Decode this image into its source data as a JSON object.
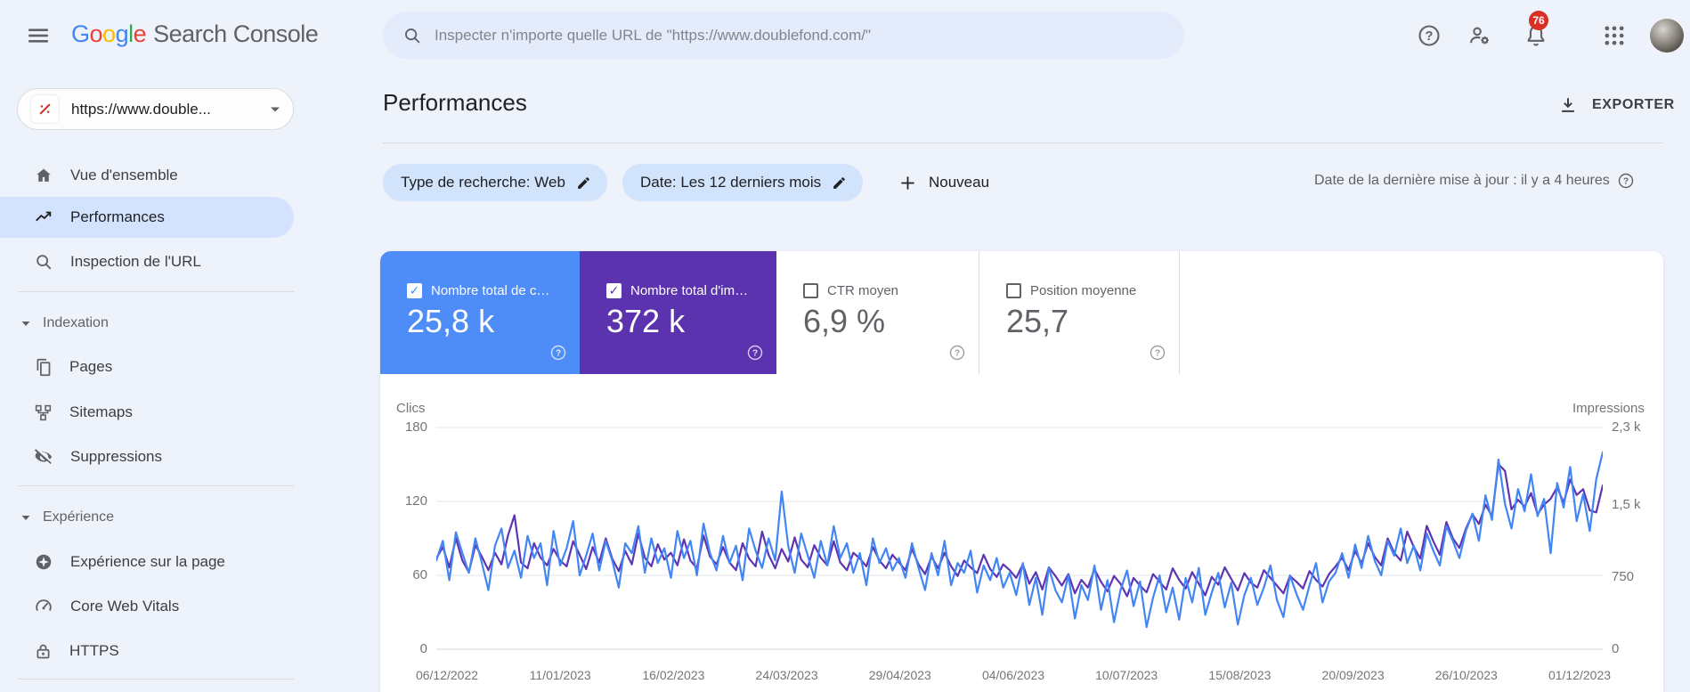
{
  "header": {
    "logo": {
      "letters": [
        {
          "ch": "G",
          "color": "#4285F4"
        },
        {
          "ch": "o",
          "color": "#EA4335"
        },
        {
          "ch": "o",
          "color": "#FBBC05"
        },
        {
          "ch": "g",
          "color": "#4285F4"
        },
        {
          "ch": "l",
          "color": "#34A853"
        },
        {
          "ch": "e",
          "color": "#EA4335"
        }
      ],
      "product": "Search Console"
    },
    "search": {
      "placeholder": "Inspecter n'importe quelle URL de \"https://www.doublefond.com/\""
    },
    "notifications_count": "76"
  },
  "sidebar": {
    "property": {
      "url": "https://www.double..."
    },
    "items": [
      {
        "label": "Vue d'ensemble"
      },
      {
        "label": "Performances"
      },
      {
        "label": "Inspection de l'URL"
      },
      {
        "label": "Pages"
      },
      {
        "label": "Sitemaps"
      },
      {
        "label": "Suppressions"
      },
      {
        "label": "Expérience sur la page"
      },
      {
        "label": "Core Web Vitals"
      },
      {
        "label": "HTTPS"
      }
    ],
    "sections": [
      {
        "label": "Indexation"
      },
      {
        "label": "Expérience"
      }
    ]
  },
  "main": {
    "title": "Performances",
    "export_label": "EXPORTER",
    "filters": {
      "chip_search_type": "Type de recherche: Web",
      "chip_date": "Date: Les 12 derniers mois",
      "new_label": "Nouveau",
      "updated_text": "Date de la dernière mise à jour : il y a 4 heures"
    },
    "metrics": [
      {
        "label": "Nombre total de c…",
        "value": "25,8 k",
        "checked": true,
        "color": "#4e8cf7"
      },
      {
        "label": "Nombre total d'im…",
        "value": "372 k",
        "checked": true,
        "color": "#5c33ae"
      },
      {
        "label": "CTR moyen",
        "value": "6,9 %",
        "checked": false,
        "color": "#ffffff"
      },
      {
        "label": "Position moyenne",
        "value": "25,7",
        "checked": false,
        "color": "#ffffff"
      }
    ],
    "chart_data": {
      "type": "line",
      "title": "",
      "left_axis": {
        "label": "Clics",
        "ticks": [
          180,
          120,
          60,
          0
        ],
        "tick_labels": [
          "180",
          "120",
          "60",
          "0"
        ],
        "max": 180
      },
      "right_axis": {
        "label": "Impressions",
        "ticks": [
          2300,
          1500,
          750,
          0
        ],
        "tick_labels": [
          "2,3 k",
          "1,5 k",
          "750",
          "0"
        ],
        "max": 2300
      },
      "x_labels": [
        "06/12/2022",
        "11/01/2023",
        "16/02/2023",
        "24/03/2023",
        "29/04/2023",
        "04/06/2023",
        "10/07/2023",
        "15/08/2023",
        "20/09/2023",
        "26/10/2023",
        "01/12/2023"
      ],
      "grid": true,
      "series": [
        {
          "name": "Clics",
          "color": "#4285f4",
          "axis": "left",
          "values": [
            72,
            88,
            56,
            95,
            78,
            62,
            90,
            70,
            48,
            84,
            98,
            66,
            80,
            58,
            92,
            74,
            86,
            52,
            96,
            68,
            82,
            104,
            60,
            76,
            94,
            64,
            88,
            72,
            50,
            86,
            78,
            100,
            62,
            90,
            70,
            82,
            58,
            96,
            74,
            88,
            60,
            102,
            78,
            64,
            92,
            70,
            84,
            56,
            98,
            80,
            66,
            90,
            72,
            128,
            84,
            62,
            94,
            76,
            58,
            88,
            68,
            100,
            74,
            86,
            62,
            78,
            52,
            90,
            70,
            82,
            64,
            74,
            58,
            86,
            66,
            48,
            78,
            60,
            88,
            52,
            70,
            62,
            80,
            46,
            68,
            56,
            74,
            50,
            62,
            44,
            70,
            36,
            58,
            28,
            66,
            48,
            38,
            60,
            25,
            52,
            40,
            68,
            32,
            56,
            22,
            48,
            64,
            35,
            55,
            18,
            42,
            60,
            30,
            50,
            24,
            58,
            38,
            66,
            28,
            46,
            62,
            34,
            54,
            20,
            44,
            58,
            36,
            50,
            68,
            40,
            26,
            60,
            45,
            32,
            52,
            70,
            38,
            55,
            62,
            78,
            58,
            85,
            66,
            92,
            72,
            60,
            88,
            76,
            98,
            70,
            84,
            64,
            94,
            80,
            68,
            100,
            88,
            74,
            96,
            110,
            88,
            125,
            105,
            154,
            118,
            98,
            130,
            112,
            142,
            108,
            122,
            78,
            135,
            115,
            148,
            104,
            126,
            96,
            138,
            160
          ]
        },
        {
          "name": "Impressions",
          "color": "#5e35b1",
          "axis": "right",
          "values": [
            940,
            1060,
            850,
            1150,
            920,
            800,
            1080,
            960,
            820,
            1000,
            880,
            1180,
            1390,
            900,
            840,
            1100,
            950,
            870,
            1040,
            920,
            860,
            1120,
            980,
            830,
            1060,
            900,
            1150,
            940,
            810,
            1020,
            880,
            1200,
            950,
            860,
            1090,
            930,
            1000,
            870,
            1140,
            920,
            840,
            1180,
            960,
            880,
            1060,
            900,
            820,
            1100,
            940,
            860,
            1220,
            980,
            840,
            1040,
            910,
            1160,
            930,
            850,
            1080,
            950,
            870,
            1120,
            900,
            820,
            1000,
            940,
            860,
            1060,
            920,
            840,
            980,
            900,
            820,
            1040,
            880,
            780,
            960,
            840,
            1000,
            860,
            760,
            920,
            850,
            790,
            980,
            830,
            750,
            880,
            820,
            740,
            880,
            680,
            800,
            620,
            850,
            760,
            660,
            780,
            580,
            720,
            640,
            830,
            700,
            600,
            760,
            680,
            550,
            740,
            660,
            590,
            780,
            700,
            620,
            840,
            720,
            630,
            800,
            680,
            560,
            750,
            670,
            850,
            730,
            610,
            790,
            690,
            640,
            820,
            740,
            660,
            580,
            760,
            700,
            630,
            810,
            720,
            650,
            780,
            860,
            950,
            820,
            1020,
            890,
            1100,
            960,
            870,
            1150,
            1000,
            920,
            1220,
            1060,
            940,
            1280,
            1120,
            980,
            1320,
            1150,
            1050,
            1250,
            1400,
            1300,
            1500,
            1380,
            1920,
            1850,
            1450,
            1550,
            1480,
            1620,
            1400,
            1500,
            1560,
            1680,
            1520,
            1760,
            1600,
            1660,
            1440,
            1420,
            1700
          ]
        }
      ]
    }
  }
}
